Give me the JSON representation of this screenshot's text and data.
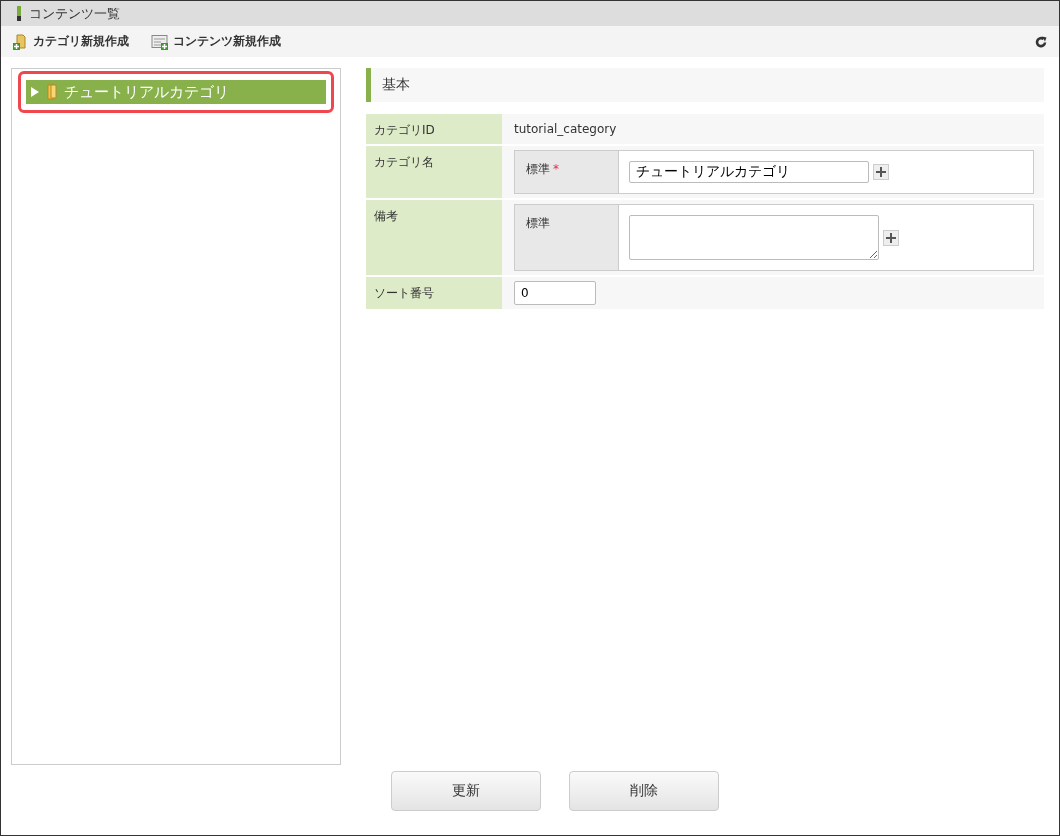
{
  "window": {
    "title": "コンテンツ一覧"
  },
  "toolbar": [
    {
      "label": "カテゴリ新規作成",
      "kind": "category"
    },
    {
      "label": "コンテンツ新規作成",
      "kind": "content"
    }
  ],
  "tree": [
    {
      "label": "チュートリアルカテゴリ",
      "selected": true,
      "expanded": false,
      "highlighted": true
    }
  ],
  "section": {
    "title": "基本"
  },
  "fields": [
    {
      "kind": "static",
      "label": "カテゴリID",
      "value": "tutorial_category"
    },
    {
      "kind": "localized",
      "label": "カテゴリ名",
      "lang": "標準",
      "required_mark": "*",
      "value": "チュートリアルカテゴリ",
      "multiline": false
    },
    {
      "kind": "localized",
      "label": "備考",
      "lang": "標準",
      "multiline": true
    },
    {
      "kind": "number",
      "label": "ソート番号",
      "value": "0"
    }
  ],
  "buttons": [
    "更新",
    "削除"
  ]
}
